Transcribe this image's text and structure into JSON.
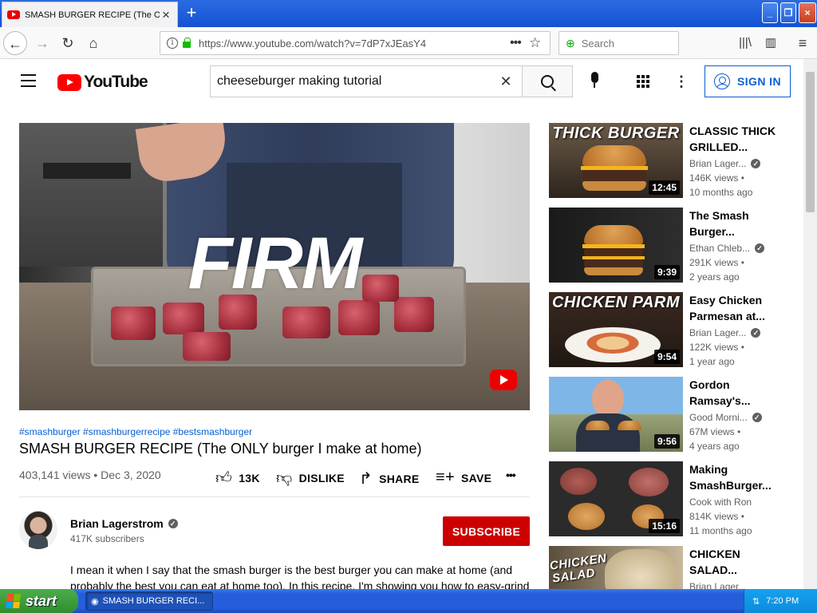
{
  "browser": {
    "tab_title": "SMASH BURGER RECIPE (The ONL",
    "url": "https://www.youtube.com/watch?v=7dP7xJEasY4",
    "search_placeholder": "Search"
  },
  "header": {
    "logo_text": "YouTube",
    "search_query": "cheeseburger making tutorial",
    "sign_in_label": "SIGN IN"
  },
  "video": {
    "overlay_text": "FIRM",
    "hashtags": "#smashburger #smashburgerrecipe #bestsmashburger",
    "title": "SMASH BURGER RECIPE (The ONLY burger I make at home)",
    "meta": "403,141 views • Dec 3, 2020",
    "likes": "13K",
    "dislike_label": "DISLIKE",
    "share_label": "SHARE",
    "save_label": "SAVE",
    "more_label": "•••"
  },
  "channel": {
    "name": "Brian Lagerstrom",
    "subscribers": "417K subscribers",
    "subscribe_label": "SUBSCRIBE"
  },
  "description": "I mean it when I say that the smash burger is the best burger you can make at home (and probably the best you can eat at home too). In this recipe, I'm showing you how to easy-grind",
  "related": [
    {
      "thumb_text": "THICK BURGER",
      "duration": "12:45",
      "title": "CLASSIC THICK GRILLED...",
      "channel": "Brian Lager...",
      "verified": true,
      "views": "146K views •",
      "age": "10 months ago"
    },
    {
      "thumb_text": "",
      "duration": "9:39",
      "title": "The Smash Burger...",
      "channel": "Ethan Chleb...",
      "verified": true,
      "views": "291K views •",
      "age": "2 years ago"
    },
    {
      "thumb_text": "CHICKEN PARM",
      "duration": "9:54",
      "title": "Easy Chicken Parmesan at...",
      "channel": "Brian Lager...",
      "verified": true,
      "views": "122K views •",
      "age": "1 year ago"
    },
    {
      "thumb_text": "",
      "duration": "9:56",
      "title": "Gordon Ramsay's...",
      "channel": "Good Morni...",
      "verified": true,
      "views": "67M views •",
      "age": "4 years ago"
    },
    {
      "thumb_text": "",
      "duration": "15:16",
      "title": "Making SmashBurger...",
      "channel": "Cook with Ron",
      "verified": false,
      "views": "814K views •",
      "age": "11 months ago"
    },
    {
      "thumb_text": "CHICKEN SALAD",
      "duration": "",
      "title": "CHICKEN SALAD...",
      "channel": "Brian Lager...",
      "verified": false,
      "views": "",
      "age": ""
    }
  ],
  "taskbar": {
    "start_label": "start",
    "task_label": "SMASH BURGER RECI...",
    "clock": "7:20 PM"
  },
  "colors": {
    "brand_red": "#ff0000",
    "subscribe_red": "#cc0000",
    "link_blue": "#065fd4"
  }
}
